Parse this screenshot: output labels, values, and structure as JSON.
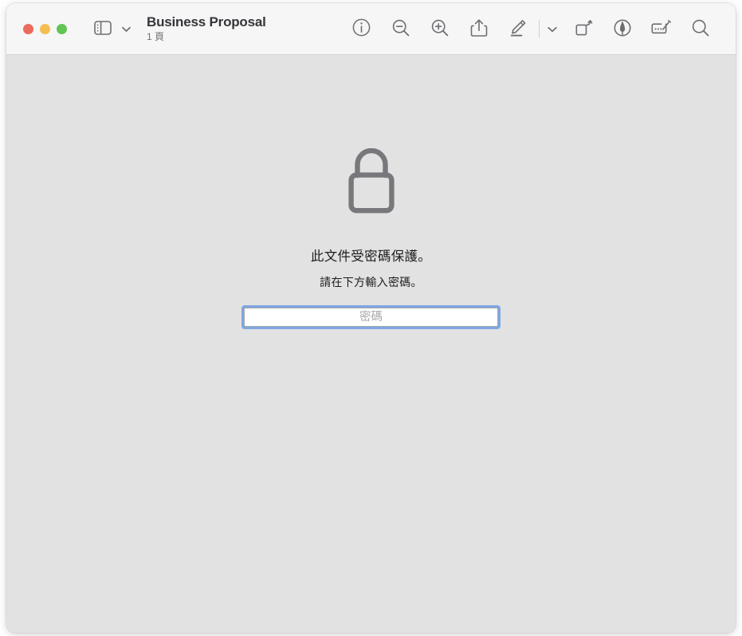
{
  "window": {
    "traffic_lights": [
      {
        "name": "close",
        "color": "#ec6a5e"
      },
      {
        "name": "minimize",
        "color": "#f4bf50"
      },
      {
        "name": "zoom",
        "color": "#61c454"
      }
    ],
    "title": "Business Proposal",
    "subtitle": "1 頁"
  },
  "toolbar": {
    "sidebar_icon": "sidebar-icon",
    "sidebar_chevron_icon": "chevron-down-icon",
    "items": [
      {
        "icon": "info-icon",
        "label": "資訊"
      },
      {
        "icon": "zoom-out-icon",
        "label": "縮小"
      },
      {
        "icon": "zoom-in-icon",
        "label": "放大"
      },
      {
        "icon": "share-icon",
        "label": "分享"
      },
      {
        "icon": "markup-pen-icon",
        "label": "標示"
      },
      {
        "icon": "chevron-down-icon",
        "label": "標示選項"
      },
      {
        "icon": "rotate-icon",
        "label": "旋轉"
      },
      {
        "icon": "ink-annotate-icon",
        "label": "註解"
      },
      {
        "icon": "signature-icon",
        "label": "簽名檔"
      },
      {
        "icon": "search-icon",
        "label": "搜尋"
      }
    ]
  },
  "main": {
    "lock_icon": "lock-icon",
    "message_primary": "此文件受密碼保護。",
    "message_secondary": "請在下方輸入密碼。",
    "password_field": {
      "value": "",
      "placeholder": "密碼",
      "focus_ring_color": "#7ea7e3"
    }
  },
  "colors": {
    "titlebar_bg": "#f6f6f6",
    "content_bg": "#e2e2e2",
    "icon_stroke": "#6e6e73",
    "lock_stroke": "#78787c",
    "title_text": "#35353a",
    "subtitle_text": "#737377",
    "body_text": "#1d1d1f"
  }
}
